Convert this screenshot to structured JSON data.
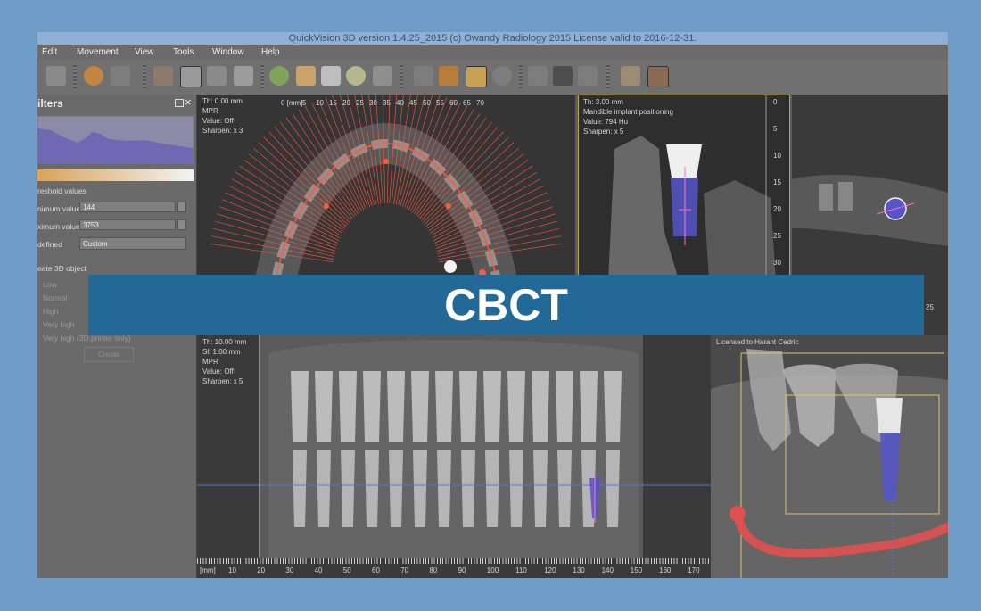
{
  "window": {
    "title": "QuickVision 3D version 1.4.25_2015 (c) Owandy Radiology 2015 License valid to 2016-12-31."
  },
  "menu": [
    "Edit",
    "Movement",
    "View",
    "Tools",
    "Window",
    "Help"
  ],
  "filters_panel": {
    "title": "ilters",
    "threshold_heading": "reshold values",
    "min_label": "nimum value",
    "min_value": "144",
    "max_label": "ximum value",
    "max_value": "3753",
    "predefined_label": "defined",
    "predefined_value": "Custom",
    "create_heading": "eate 3D object",
    "quality_options": [
      "Low",
      "Normal",
      "High",
      "Very high",
      "Very high (3D printer only)"
    ],
    "create_button": "Create"
  },
  "viewports": {
    "axial": {
      "info": [
        "Th: 0.00 mm",
        "MPR",
        "Value: Off",
        "Sharpen: x 3"
      ],
      "ruler_unit": "0 [mm]",
      "ruler_ticks": [
        "5",
        "10",
        "15",
        "20",
        "25",
        "30",
        "35",
        "40",
        "45",
        "50",
        "55",
        "60",
        "65",
        "70"
      ]
    },
    "cross_section": {
      "info": [
        "Th: 3.00 mm",
        "Mandible implant positioning",
        "Value: 794 Hu",
        "Sharpen: x 5"
      ],
      "scale_ticks": [
        "0",
        "5",
        "10",
        "15",
        "20",
        "25",
        "30"
      ]
    },
    "side_view": {
      "scale_tick": "25"
    },
    "panoramic": {
      "info": [
        "Th: 10.00 mm",
        "Sl: 1.00 mm",
        "MPR",
        "Value: Off",
        "Sharpen: x 5"
      ],
      "ruler_unit": "[mm]",
      "ruler_ticks": [
        "10",
        "20",
        "30",
        "40",
        "50",
        "60",
        "70",
        "80",
        "90",
        "100",
        "110",
        "120",
        "130",
        "140",
        "150",
        "160",
        "170"
      ]
    },
    "render3d": {
      "license": "Licensed to Harant Cedric"
    }
  },
  "banner": {
    "text": "CBCT"
  },
  "colors": {
    "background": "#6f9cc7",
    "banner": "#236998",
    "implant": "#5555c8",
    "nerve": "#e05050",
    "ruler_rays": "#ff5a3c"
  }
}
